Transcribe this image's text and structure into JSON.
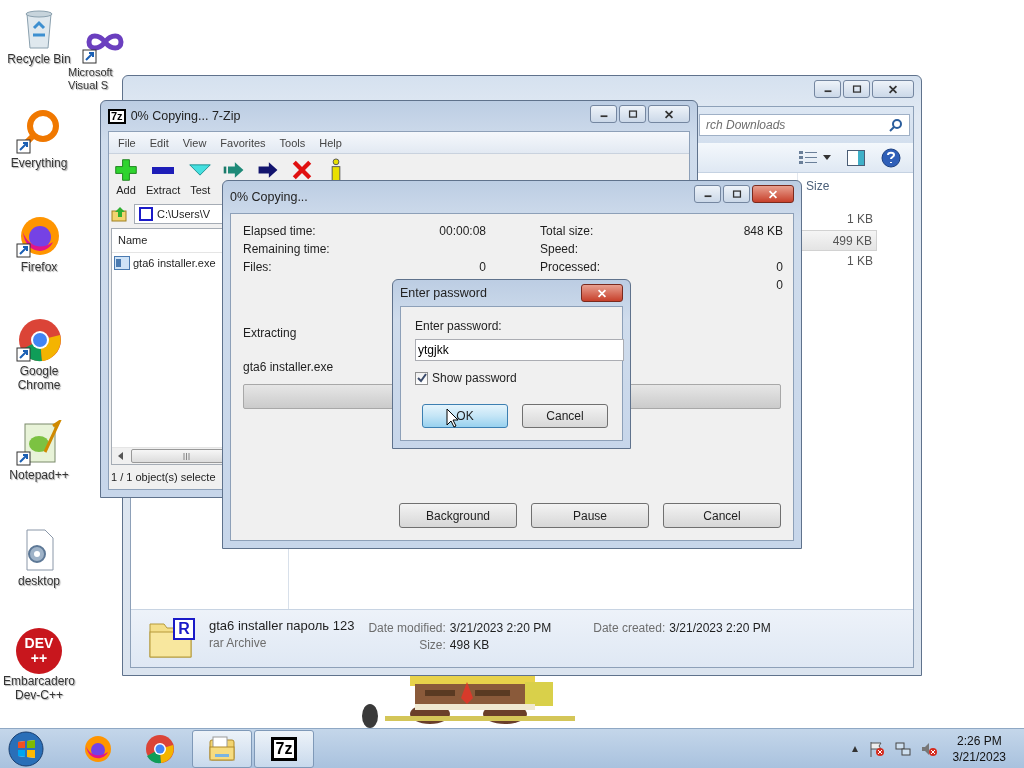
{
  "desktop_icons": [
    {
      "kind": "recycle-bin",
      "label": "Recycle Bin"
    },
    {
      "kind": "visual-studio",
      "label": "Microsoft Visual S"
    },
    {
      "kind": "everything",
      "label": "Everything"
    },
    {
      "kind": "firefox",
      "label": "Firefox"
    },
    {
      "kind": "chrome",
      "label": "Google Chrome"
    },
    {
      "kind": "notepad",
      "label": "Notepad++"
    },
    {
      "kind": "document",
      "label": "desktop"
    },
    {
      "kind": "dev-cpp",
      "label": "Embarcadero Dev-C++",
      "logo_text": [
        "DEV",
        "++"
      ]
    }
  ],
  "explorer": {
    "search": {
      "placeholder": "rch Downloads"
    },
    "columns": [
      "Size"
    ],
    "rows": [
      {
        "size": "1 KB",
        "selected": false
      },
      {
        "size": "499 KB",
        "selected": true
      },
      {
        "size": "1 KB",
        "selected": false
      }
    ],
    "details": {
      "icon_text": "R",
      "file_name": "gta6 installer пароль 123",
      "file_type": "rar Archive",
      "field_columns": [
        [
          {
            "label": "Date modified:",
            "value": "3/21/2023 2:20 PM"
          },
          {
            "label": "Size:",
            "value": "498 KB"
          }
        ],
        [
          {
            "label": "Date created:",
            "value": "3/21/2023 2:20 PM"
          }
        ]
      ]
    }
  },
  "seven_zip": {
    "logo_text": "7z",
    "title": "0% Copying... 7-Zip",
    "menu": [
      "File",
      "Edit",
      "View",
      "Favorites",
      "Tools",
      "Help"
    ],
    "toolbar": [
      {
        "kind": "add",
        "label": "Add"
      },
      {
        "kind": "extract",
        "label": "Extract"
      },
      {
        "kind": "test",
        "label": "Test"
      },
      {
        "kind": "copy"
      },
      {
        "kind": "move"
      },
      {
        "kind": "delete"
      },
      {
        "kind": "info"
      }
    ],
    "path": "C:\\Users\\V",
    "columns": [
      "Name"
    ],
    "rows": [
      {
        "name": "gta6 installer.exe"
      }
    ],
    "status": "1 / 1 object(s) selecte"
  },
  "progress": {
    "title": "0% Copying...",
    "stats_left": [
      {
        "label": "Elapsed time:",
        "value": "00:00:08"
      },
      {
        "label": "Remaining time:"
      },
      {
        "label": "Files:",
        "value": "0"
      }
    ],
    "stats_right": [
      {
        "label": "Total size:",
        "value": "848 KB"
      },
      {
        "label": "Speed:"
      },
      {
        "label": "Processed:",
        "value": "0"
      },
      {
        "value": "0"
      }
    ],
    "status": "Extracting",
    "current_file": "gta6 installer.exe",
    "level": 0,
    "buttons": [
      "Background",
      "Pause",
      "Cancel"
    ]
  },
  "password_dialog": {
    "title": "Enter password",
    "prompt": "Enter password:",
    "value": "ytgjkk",
    "show_password": {
      "label": "Show password",
      "checked": true
    },
    "buttons": [
      {
        "label": "OK",
        "focused": true
      },
      {
        "label": "Cancel",
        "focused": false
      }
    ]
  },
  "taskbar": {
    "apps": [
      {
        "kind": "firefox",
        "open": false
      },
      {
        "kind": "chrome",
        "open": false
      },
      {
        "kind": "explorer",
        "open": true
      },
      {
        "kind": "seven-zip",
        "open": true,
        "logo_text": "7z"
      }
    ],
    "clock": {
      "time": "2:26 PM",
      "date": "3/21/2023"
    }
  }
}
